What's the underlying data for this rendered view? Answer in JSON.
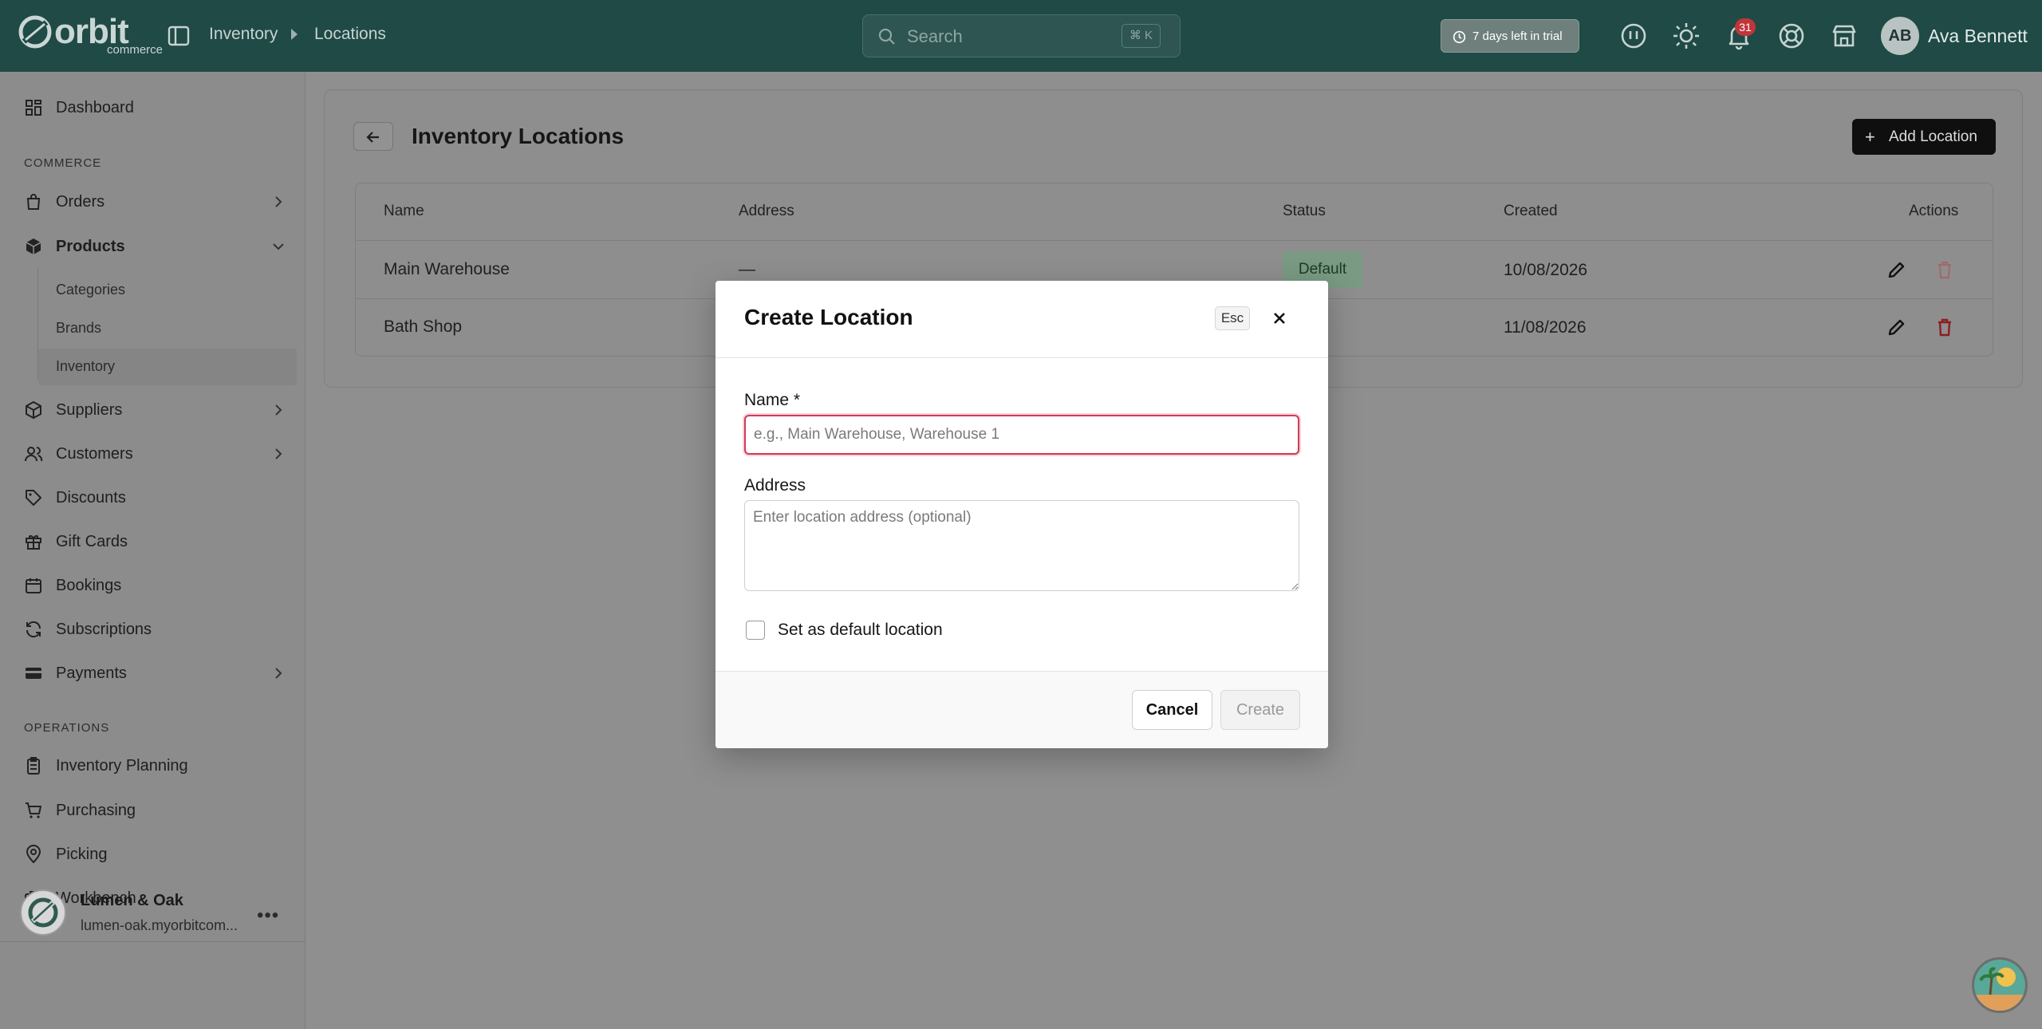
{
  "brand": {
    "logo_word": "orbit",
    "logo_sub": "commerce"
  },
  "breadcrumb": {
    "parent": "Inventory",
    "current": "Locations"
  },
  "search": {
    "placeholder": "Search",
    "shortcut": "⌘ K"
  },
  "trial": {
    "label": "7 days left in trial"
  },
  "notifications": {
    "count": "31"
  },
  "user": {
    "initials": "AB",
    "name": "Ava Bennett"
  },
  "sidebar": {
    "dashboard": "Dashboard",
    "commerce_label": "COMMERCE",
    "orders": "Orders",
    "products": "Products",
    "categories": "Categories",
    "brands": "Brands",
    "inventory": "Inventory",
    "suppliers": "Suppliers",
    "customers": "Customers",
    "discounts": "Discounts",
    "gift_cards": "Gift Cards",
    "bookings": "Bookings",
    "subscriptions": "Subscriptions",
    "payments": "Payments",
    "operations_label": "OPERATIONS",
    "inventory_planning": "Inventory Planning",
    "purchasing": "Purchasing",
    "picking": "Picking",
    "workbench": "Workbench"
  },
  "store": {
    "name": "Lumen & Oak",
    "url": "lumen-oak.myorbitcom..."
  },
  "page": {
    "title": "Inventory Locations",
    "add_button": "Add Location"
  },
  "table": {
    "headers": {
      "name": "Name",
      "address": "Address",
      "status": "Status",
      "created": "Created",
      "actions": "Actions"
    },
    "rows": [
      {
        "name": "Main Warehouse",
        "address": "—",
        "status": "Default",
        "created": "10/08/2026"
      },
      {
        "name": "Bath Shop",
        "address": "",
        "status": "",
        "created": "11/08/2026"
      }
    ]
  },
  "modal": {
    "title": "Create Location",
    "esc": "Esc",
    "name_label": "Name *",
    "name_placeholder": "e.g., Main Warehouse, Warehouse 1",
    "address_label": "Address",
    "address_placeholder": "Enter location address (optional)",
    "default_checkbox_label": "Set as default location",
    "cancel": "Cancel",
    "create": "Create"
  },
  "colors": {
    "topbar": "#1f4a46",
    "danger": "#d33a55",
    "badge_green": "#7a9a83"
  }
}
